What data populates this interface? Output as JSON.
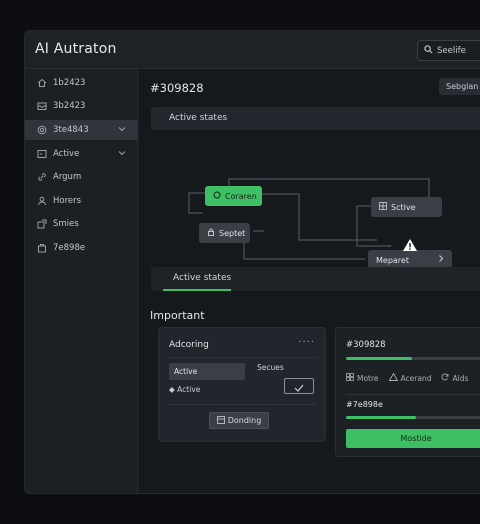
{
  "app": {
    "title": "AI Autraton"
  },
  "header": {
    "search_label": "Seelife"
  },
  "sidebar": {
    "items": [
      {
        "label": "1b2423",
        "icon": "home-icon"
      },
      {
        "label": "3b2423",
        "icon": "inbox-icon"
      },
      {
        "label": "3te4843",
        "icon": "target-icon",
        "active": true
      },
      {
        "label": "Active",
        "icon": "square-icon"
      },
      {
        "label": "Argum",
        "icon": "link-icon"
      },
      {
        "label": "Horers",
        "icon": "user-icon"
      },
      {
        "label": "Smies",
        "icon": "share-icon"
      },
      {
        "label": "7e898e",
        "icon": "bag-icon"
      }
    ]
  },
  "main": {
    "title": "#309828",
    "chip_label": "Sebglan",
    "panel_title": "Active states",
    "graph": {
      "nodes": {
        "start": "Coraren",
        "middle": "Septet",
        "active": "Sctive",
        "end": "Meparet"
      }
    },
    "tab_label": "Active states",
    "section_title": "Important"
  },
  "card": {
    "title": "Adcoring",
    "selected_row": "Active",
    "secondary_label": "Secues",
    "item": "Active",
    "button_label": "Donding"
  },
  "card2": {
    "title": "#309828",
    "progress1": 0.47,
    "icons": [
      {
        "label": "Motre",
        "icon": "grid-icon"
      },
      {
        "label": "Acerand",
        "icon": "warning-icon"
      },
      {
        "label": "Alds",
        "icon": "refresh-icon"
      }
    ],
    "subtitle": "#7e898e",
    "progress2": 0.5,
    "button_label": "Mostide"
  },
  "colors": {
    "accent": "#3fbf63",
    "bg": "#15181c"
  }
}
